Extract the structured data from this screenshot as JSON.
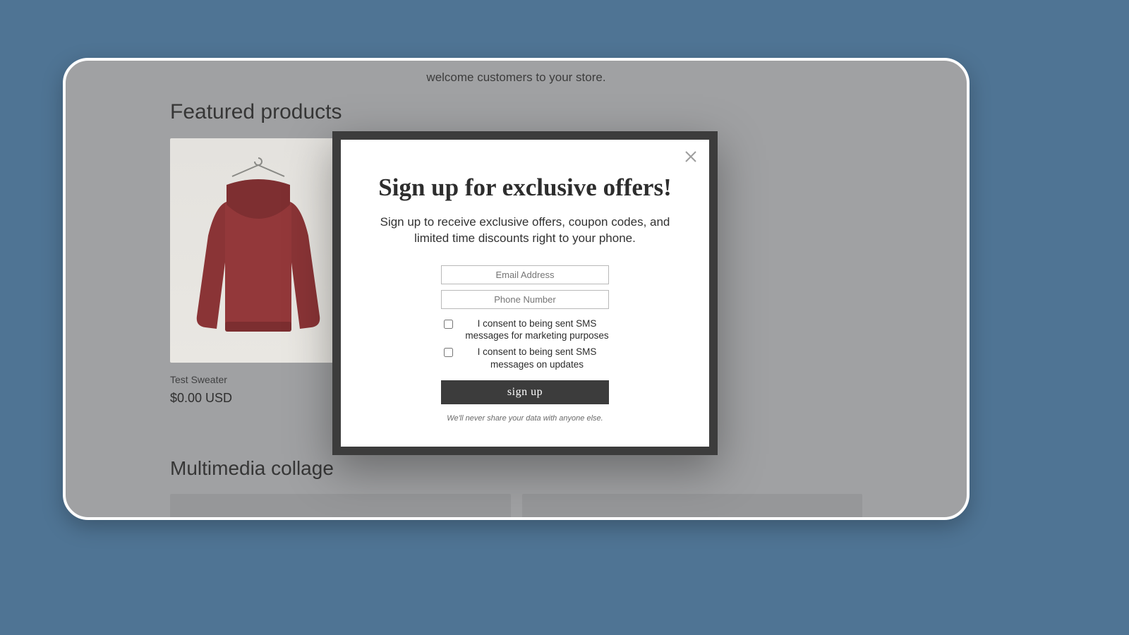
{
  "store": {
    "tagline_fragment": "welcome customers to your store.",
    "featured_heading": "Featured products",
    "product": {
      "name": "Test Sweater",
      "price": "$0.00 USD"
    },
    "collage_heading": "Multimedia collage"
  },
  "modal": {
    "title": "Sign up for exclusive offers!",
    "subtitle": "Sign up to receive exclusive offers, coupon codes, and limited time discounts right to your phone.",
    "email_placeholder": "Email Address",
    "phone_placeholder": "Phone Number",
    "consent_marketing": "I consent to being sent SMS messages for marketing purposes",
    "consent_updates": "I consent to being sent SMS messages on updates",
    "submit_label": "sign up",
    "privacy_note": "We'll never share your data with anyone else."
  }
}
